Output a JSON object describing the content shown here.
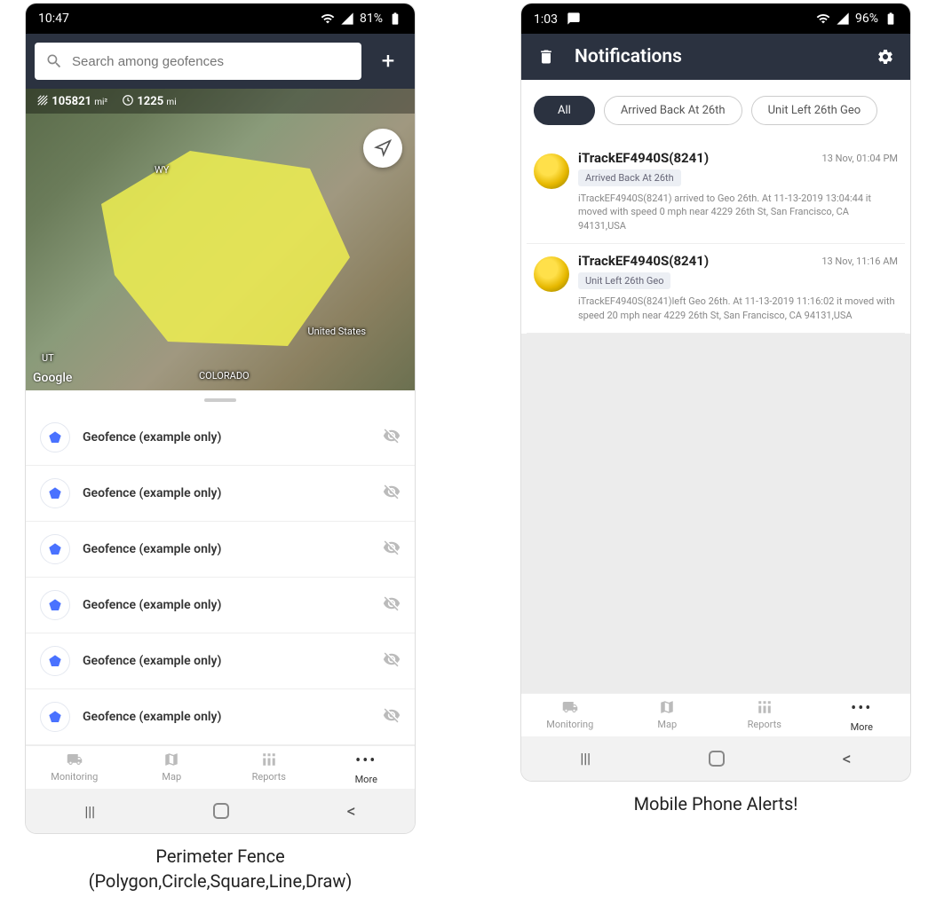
{
  "left": {
    "status": {
      "time": "10:47",
      "battery": "81%"
    },
    "search": {
      "placeholder": "Search among geofences"
    },
    "map": {
      "area_val": "105821",
      "area_unit": "mi²",
      "perimeter_val": "1225",
      "perimeter_unit": "mi",
      "label_wy": "WY",
      "label_ut": "UT",
      "label_co": "COLORADO",
      "label_us": "United States",
      "logo": "Google"
    },
    "geofences": [
      {
        "name": "Geofence (example only)"
      },
      {
        "name": "Geofence (example only)"
      },
      {
        "name": "Geofence (example only)"
      },
      {
        "name": "Geofence (example only)"
      },
      {
        "name": "Geofence (example only)"
      },
      {
        "name": "Geofence (example only)"
      }
    ],
    "nav": {
      "monitoring": "Monitoring",
      "map": "Map",
      "reports": "Reports",
      "more": "More"
    },
    "caption1": "Perimeter Fence",
    "caption2": "(Polygon,Circle,Square,Line,Draw)"
  },
  "right": {
    "status": {
      "time": "1:03",
      "battery": "96%"
    },
    "header": {
      "title": "Notifications"
    },
    "chips": {
      "all": "All",
      "arrived": "Arrived Back At 26th",
      "left": "Unit Left 26th Geo"
    },
    "items": [
      {
        "title": "iTrackEF4940S(8241)",
        "time": "13 Nov, 01:04 PM",
        "tag": "Arrived Back At 26th",
        "desc": "iTrackEF4940S(8241) arrived to Geo 26th.      At 11-13-2019 13:04:44 it moved with speed 0 mph near 4229 26th St, San Francisco, CA 94131,USA"
      },
      {
        "title": "iTrackEF4940S(8241)",
        "time": "13 Nov, 11:16 AM",
        "tag": "Unit Left 26th Geo",
        "desc": "iTrackEF4940S(8241)left Geo 26th.      At 11-13-2019 11:16:02 it moved with speed 20 mph near 4229 26th St, San Francisco, CA 94131,USA"
      }
    ],
    "nav": {
      "monitoring": "Monitoring",
      "map": "Map",
      "reports": "Reports",
      "more": "More"
    },
    "caption": "Mobile Phone Alerts!"
  }
}
